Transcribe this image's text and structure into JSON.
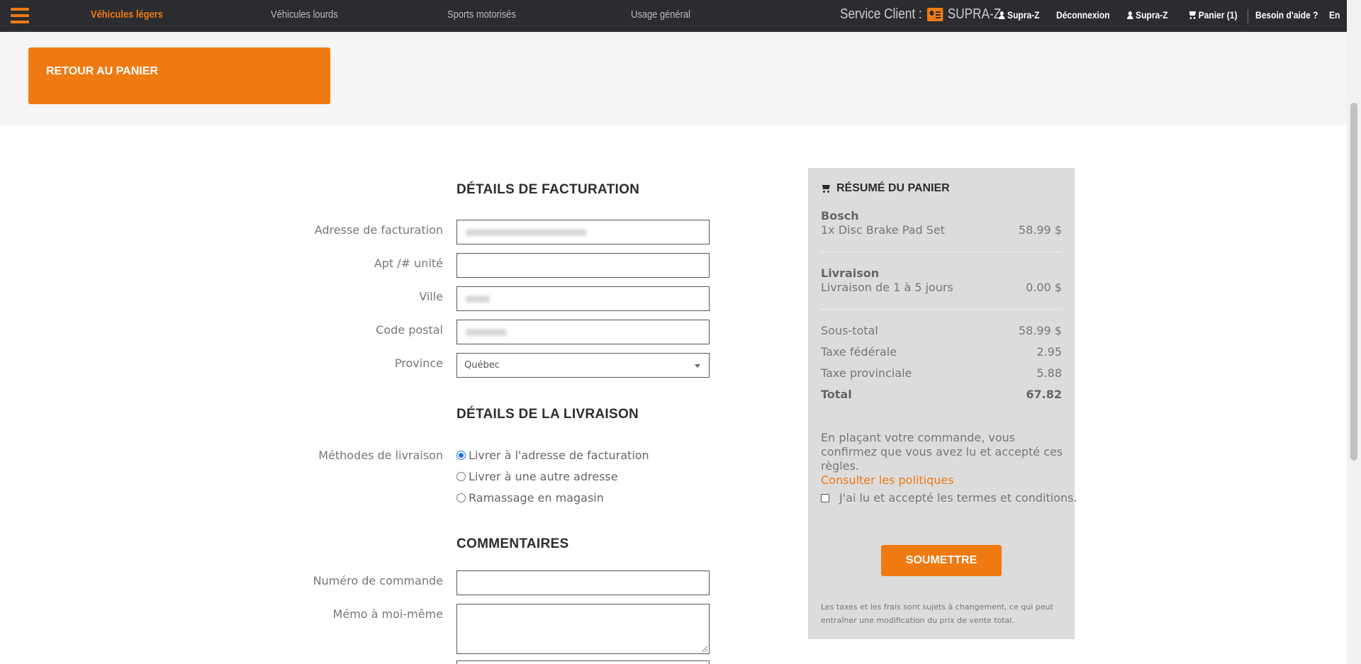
{
  "nav": {
    "links": [
      "Véhicules légers",
      "Véhicules lourds",
      "Sports motorisés",
      "Usage général"
    ],
    "service_label": "Service Client :",
    "service_brand": "SUPRA-Z",
    "account_name": "Supra-Z",
    "logout": "Déconnexion",
    "user_name": "Supra-Z",
    "cart": "Panier (1)",
    "help": "Besoin d'aide ?",
    "lang": "En"
  },
  "back_button": "RETOUR AU PANIER",
  "billing": {
    "title": "DÉTAILS DE FACTURATION",
    "address_label": "Adresse de facturation",
    "apt_label": "Apt /# unité",
    "city_label": "Ville",
    "postal_label": "Code postal",
    "province_label": "Province",
    "province_value": "Québec"
  },
  "shipping": {
    "title": "DÉTAILS DE LA LIVRAISON",
    "methods_label": "Méthodes de livraison",
    "options": [
      "Livrer à l'adresse de facturation",
      "Livrer à une autre adresse",
      "Ramassage en magasin"
    ],
    "selected": 0
  },
  "comments": {
    "title": "COMMENTAIRES",
    "order_number_label": "Numéro de commande",
    "memo_label": "Mémo à moi-même"
  },
  "summary": {
    "title": "RÉSUMÉ DU PANIER",
    "item_brand": "Bosch",
    "item_desc": "1x Disc Brake Pad Set",
    "item_price": "58.99 $",
    "delivery_title": "Livraison",
    "delivery_desc": "Livraison de 1 à 5 jours",
    "delivery_price": "0.00 $",
    "subtotal_label": "Sous-total",
    "subtotal_value": "58.99 $",
    "federal_label": "Taxe fédérale",
    "federal_value": "2.95",
    "provincial_label": "Taxe provinciale",
    "provincial_value": "5.88",
    "total_label": "Total",
    "total_value": "67.82",
    "policy_text": "En plaçant votre commande, vous confirmez que vous avez lu et accepté ces règles.",
    "policy_link": "Consulter les politiques",
    "terms_label": "J'ai lu et accepté les termes et conditions.",
    "submit": "SOUMETTRE",
    "fineprint": "Les taxes et les frais sont sujets à changement, ce qui peut entraîner une modification du prix de vente total."
  },
  "colors": {
    "accent": "#f07a12",
    "nav_bg": "#2b2c30"
  }
}
